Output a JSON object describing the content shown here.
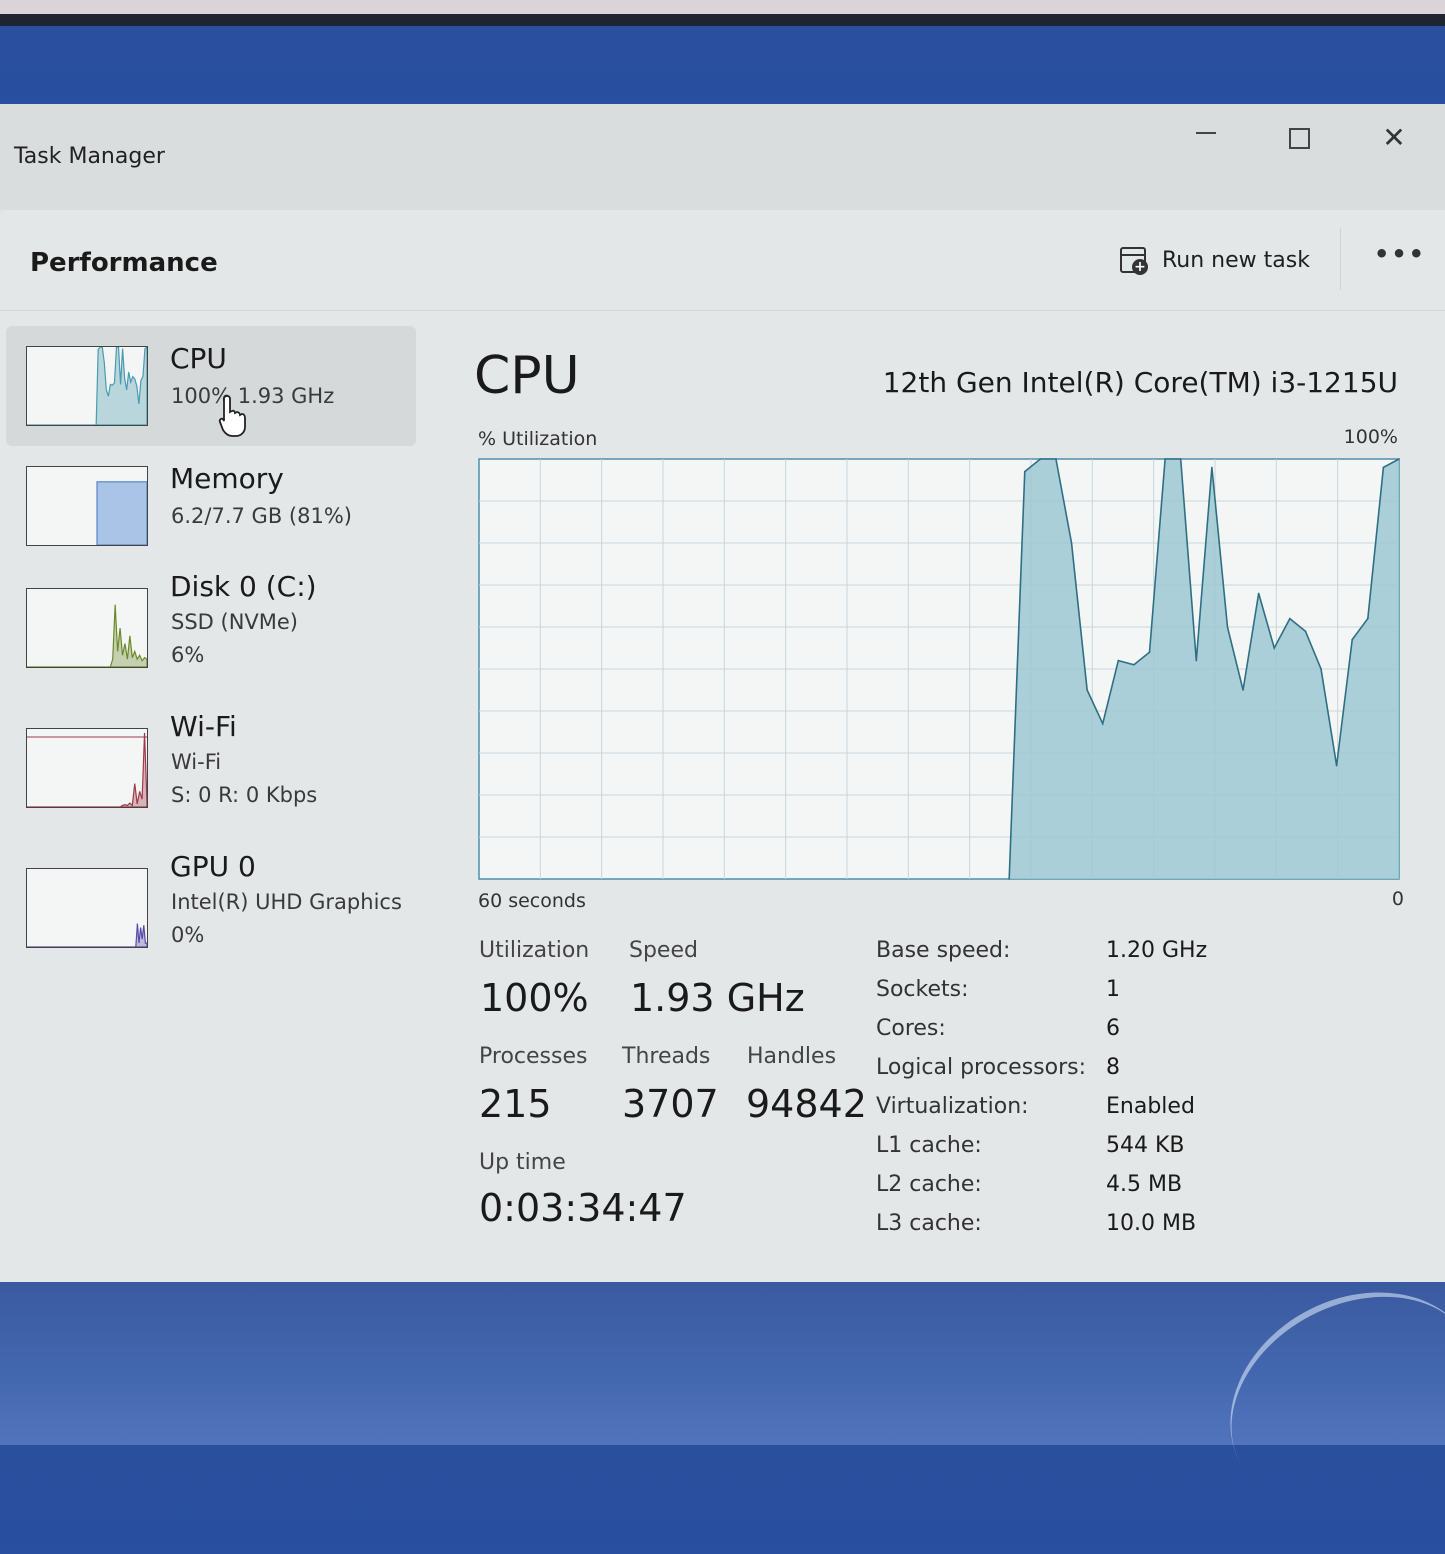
{
  "window": {
    "title": "Task Manager",
    "minimize_icon": "minimize-icon",
    "maximize_icon": "maximize-icon",
    "close_glyph": "✕"
  },
  "header": {
    "title": "Performance",
    "run_task_label": "Run new task",
    "more_glyph": "•••"
  },
  "sidebar": {
    "items": [
      {
        "name": "CPU",
        "sub1": "100%  1.93 GHz",
        "sub2": "",
        "color": "#4a9ab0"
      },
      {
        "name": "Memory",
        "sub1": "6.2/7.7 GB (81%)",
        "sub2": "",
        "color": "#5a86c8"
      },
      {
        "name": "Disk 0 (C:)",
        "sub1": "SSD (NVMe)",
        "sub2": "6%",
        "color": "#6a8a2a"
      },
      {
        "name": "Wi-Fi",
        "sub1": "Wi-Fi",
        "sub2": "S: 0 R: 0 Kbps",
        "color": "#a03a4a"
      },
      {
        "name": "GPU 0",
        "sub1": "Intel(R) UHD Graphics",
        "sub2": "0%",
        "color": "#5a4aa8"
      }
    ]
  },
  "main": {
    "title": "CPU",
    "model": "12th Gen Intel(R) Core(TM) i3-1215U",
    "util_label": "% Utilization",
    "util_max": "100%",
    "axis_left": "60 seconds",
    "axis_right": "0",
    "graph_color": "#4a90a8",
    "graph_fill": "#9cc8d4"
  },
  "chart_data": {
    "type": "area",
    "x_range_seconds": [
      60,
      0
    ],
    "ylim": [
      0,
      100
    ],
    "grid": true,
    "values": [
      0,
      0,
      0,
      0,
      0,
      0,
      0,
      0,
      0,
      0,
      0,
      0,
      0,
      0,
      0,
      0,
      0,
      0,
      0,
      0,
      0,
      0,
      0,
      0,
      0,
      0,
      0,
      0,
      0,
      0,
      0,
      0,
      0,
      0,
      0,
      97,
      100,
      100,
      80,
      45,
      37,
      52,
      51,
      54,
      100,
      100,
      52,
      98,
      60,
      45,
      68,
      55,
      62,
      59,
      50,
      27,
      57,
      62,
      98,
      100
    ]
  },
  "stats": {
    "utilization_label": "Utilization",
    "utilization_value": "100%",
    "speed_label": "Speed",
    "speed_value": "1.93 GHz",
    "processes_label": "Processes",
    "processes_value": "215",
    "threads_label": "Threads",
    "threads_value": "3707",
    "handles_label": "Handles",
    "handles_value": "94842",
    "uptime_label": "Up time",
    "uptime_value": "0:03:34:47"
  },
  "specs": [
    {
      "label": "Base speed:",
      "value": "1.20 GHz"
    },
    {
      "label": "Sockets:",
      "value": "1"
    },
    {
      "label": "Cores:",
      "value": "6"
    },
    {
      "label": "Logical processors:",
      "value": "8"
    },
    {
      "label": "Virtualization:",
      "value": "Enabled"
    },
    {
      "label": "L1 cache:",
      "value": "544 KB"
    },
    {
      "label": "L2 cache:",
      "value": "4.5 MB"
    },
    {
      "label": "L3 cache:",
      "value": "10.0 MB"
    }
  ]
}
